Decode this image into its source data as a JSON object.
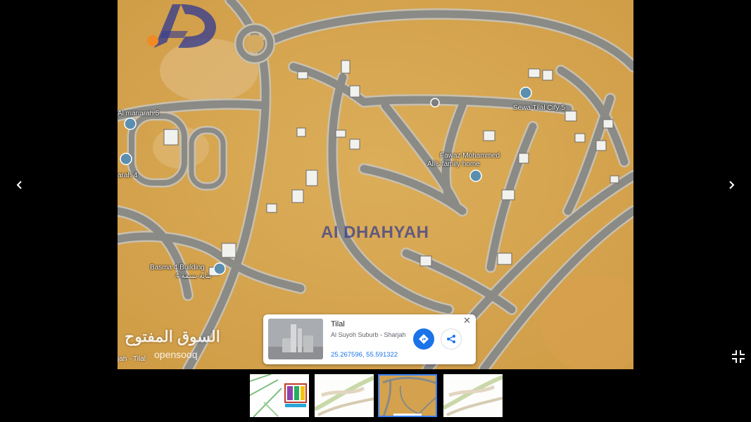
{
  "navigation": {
    "prev_icon": "chevron-left-icon",
    "next_icon": "chevron-right-icon",
    "exit_fullscreen_icon": "exit-fullscreen-icon",
    "prev_glyph": "‹",
    "next_glyph": "›"
  },
  "map": {
    "place_labels": [
      {
        "text": "Al manarah 5"
      },
      {
        "text": "arah 4"
      },
      {
        "text": "Basma 4 Building"
      },
      {
        "text": "بناية بسمة 4"
      },
      {
        "text": "Sewa Tilal Cify 5"
      },
      {
        "text": "Fawaz Mohammed"
      },
      {
        "text": "Ali's family home"
      }
    ],
    "corner_location": "jah - Tilal"
  },
  "watermark": {
    "logo_initials": "AD",
    "brand_name": "AI DHAHYAH",
    "site_arabic": "السوق المفتوح",
    "site_latin": "opensooq"
  },
  "info_card": {
    "title": "Tilal",
    "subtitle": "Al Suyoh Suburb - Sharjah",
    "coordinates": "25.267596, 55.591322",
    "close_glyph": "✕",
    "directions_icon": "directions-icon",
    "share_icon": "share-icon"
  },
  "thumbnails": {
    "count": 4,
    "active_index": 2,
    "items": [
      {
        "kind": "site-plan-colored"
      },
      {
        "kind": "master-plan"
      },
      {
        "kind": "satellite-map"
      },
      {
        "kind": "master-plan"
      }
    ]
  },
  "colors": {
    "sand": "#d9a84f",
    "road": "#8a8a86",
    "road_edge": "#b8b4aa",
    "accent_blue": "#1a73e8",
    "thumb_active": "#3b82f6",
    "watermark_blue": "#3a3f8f",
    "watermark_orange": "#f08a24"
  }
}
